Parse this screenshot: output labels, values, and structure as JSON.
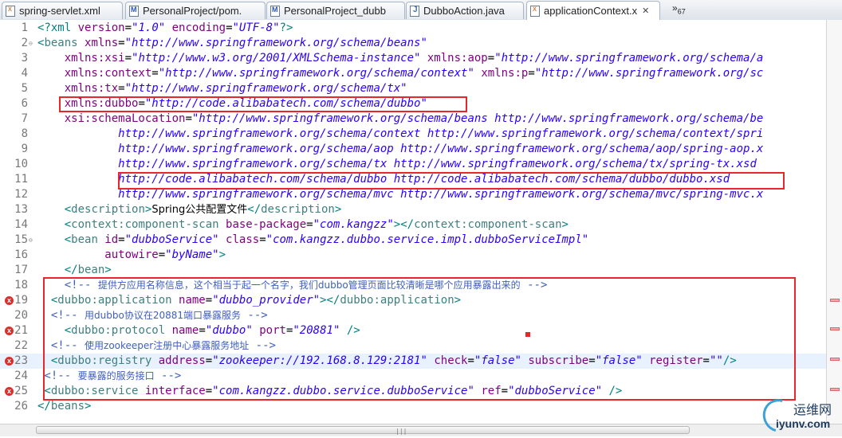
{
  "tabs": [
    {
      "label": "spring-servlet.xml",
      "icon": "xml-file-icon"
    },
    {
      "label": "PersonalProject/pom.",
      "icon": "maven-file-icon"
    },
    {
      "label": "PersonalProject_dubb",
      "icon": "maven-file-icon"
    },
    {
      "label": "DubboAction.java",
      "icon": "java-file-icon"
    },
    {
      "label": "applicationContext.x",
      "icon": "xml-file-icon",
      "active": true
    }
  ],
  "tab_overflow": {
    "symbol": "»",
    "count": "67"
  },
  "line_numbers": [
    "1",
    "2",
    "3",
    "4",
    "5",
    "6",
    "7",
    "8",
    "9",
    "10",
    "11",
    "12",
    "13",
    "14",
    "15",
    "16",
    "17",
    "18",
    "19",
    "20",
    "21",
    "22",
    "23",
    "24",
    "25",
    "26"
  ],
  "code": {
    "l1": {
      "a": "<?xml ",
      "b": "version",
      "c": "=",
      "d": "\"1.0\"",
      "e": " ",
      "f": "encoding",
      "g": "=",
      "h": "\"UTF-8\"",
      "i": "?>"
    },
    "l2": {
      "a": "<",
      "b": "beans",
      "c": " xmlns",
      "d": "=",
      "e": "\"http://www.springframework.org/schema/beans\""
    },
    "l3": {
      "a": "    xmlns:xsi",
      "b": "=",
      "c": "\"http://www.w3.org/2001/XMLSchema-instance\"",
      "d": " xmlns:aop",
      "e": "=",
      "f": "\"http://www.springframework.org/schema/a"
    },
    "l4": {
      "a": "    xmlns:context",
      "b": "=",
      "c": "\"http://www.springframework.org/schema/context\"",
      "d": " xmlns:p",
      "e": "=",
      "f": "\"http://www.springframework.org/sc"
    },
    "l5": {
      "a": "    xmlns:tx",
      "b": "=",
      "c": "\"http://www.springframework.org/schema/tx\""
    },
    "l6": {
      "a": "    xmlns:dubbo",
      "b": "=",
      "c": "\"http://code.alibabatech.com/schema/dubbo\""
    },
    "l7": {
      "a": "    xsi:schemaLocation",
      "b": "=",
      "c": "\"http://www.springframework.org/schema/beans http://www.springframework.org/schema/be"
    },
    "l8": {
      "a": "            http://www.springframework.org/schema/context http://www.springframework.org/schema/context/spri"
    },
    "l9": {
      "a": "            http://www.springframework.org/schema/aop http://www.springframework.org/schema/aop/spring-aop.x"
    },
    "l10": {
      "a": "            http://www.springframework.org/schema/tx http://www.springframework.org/schema/tx/spring-tx.xsd"
    },
    "l11": {
      "a": "            http://code.alibabatech.com/schema/dubbo http://code.alibabatech.com/schema/dubbo/dubbo.xsd"
    },
    "l12": {
      "a": "            http://www.springframework.org/schema/mvc http://www.springframework.org/schema/mvc/spring-mvc.x"
    },
    "l13": {
      "a": "    <",
      "b": "description",
      "c": ">",
      "d": "Spring公共配置文件",
      "e": "</",
      "f": "description",
      "g": ">"
    },
    "l14": {
      "a": "    <",
      "b": "context:component-scan",
      "c": " base-package",
      "d": "=",
      "e": "\"com.kangzz\"",
      "f": "></",
      "g": "context:component-scan",
      "h": ">"
    },
    "l15": {
      "a": "    <",
      "b": "bean",
      "c": " id",
      "d": "=",
      "e": "\"dubboService\"",
      "f": " class",
      "g": "=",
      "h": "\"com.kangzz.dubbo.service.impl.dubboServiceImpl\""
    },
    "l16": {
      "a": "          autowire",
      "b": "=",
      "c": "\"byName\"",
      "d": ">"
    },
    "l17": {
      "a": "    </",
      "b": "bean",
      "c": ">"
    },
    "l18": {
      "a": "    <!-- ",
      "b": "提供方应用名称信息，这个相当于起一个名字，我们dubbo管理页面比较清晰是哪个应用暴露出来的",
      "c": " -->"
    },
    "l19": {
      "a": "  <",
      "b": "dubbo:application",
      "c": " name",
      "d": "=",
      "e": "\"dubbo_provider\"",
      "f": "></",
      "g": "dubbo:application",
      "h": ">"
    },
    "l20": {
      "a": "  <!-- ",
      "b": "用dubbo协议在20881端口暴露服务",
      "c": " -->"
    },
    "l21": {
      "a": "    <",
      "b": "dubbo:protocol",
      "c": " name",
      "d": "=",
      "e": "\"dubbo\"",
      "f": " port",
      "g": "=",
      "h": "\"20881\"",
      "i": " />"
    },
    "l22": {
      "a": "  <!-- ",
      "b": "使用zookeeper注册中心暴露服务地址",
      "c": " -->"
    },
    "l23": {
      "a": "  <",
      "b": "dubbo:registry",
      "c": " address",
      "d": "=",
      "e": "\"zookeeper://192.168.8.129:2181\"",
      "f": " check",
      "g": "=",
      "h": "\"false\"",
      "i": " subscribe",
      "j": "=",
      "k": "\"false\"",
      "l": " register",
      "m": "=",
      "n": "\"\"",
      "o": "/>"
    },
    "l24": {
      "a": " <!-- ",
      "b": "要暴露的服务接口",
      "c": " -->"
    },
    "l25": {
      "a": " <",
      "b": "dubbo:service",
      "c": " interface",
      "d": "=",
      "e": "\"com.kangzz.dubbo.service.dubboService\"",
      "f": " ref",
      "g": "=",
      "h": "\"dubboService\"",
      "i": " />"
    },
    "l26": {
      "a": "</",
      "b": "beans",
      "c": ">"
    }
  },
  "error_marker": "x",
  "watermark": {
    "line1": "运维网",
    "line2": "iyunv.com"
  },
  "colors": {
    "tag": "#3f7f7f",
    "attribute": "#7f007f",
    "value": "#2a00ff",
    "comment": "#3f5fbf",
    "highlight_box": "#e8262c",
    "error": "#d9302c"
  }
}
